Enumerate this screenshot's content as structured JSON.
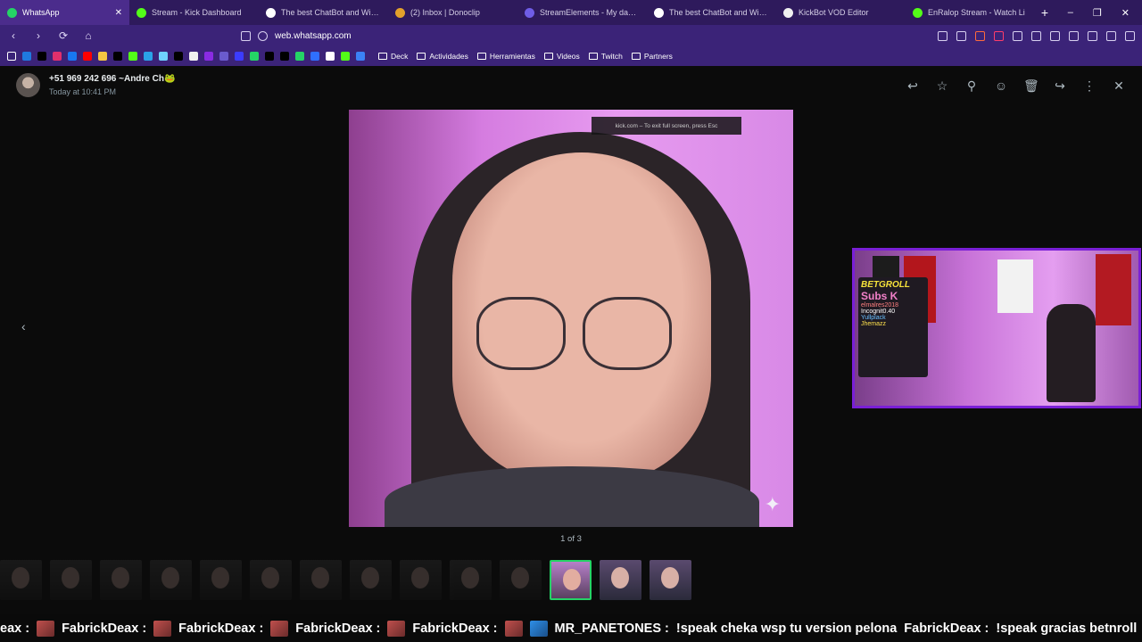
{
  "browser": {
    "tabs": [
      {
        "title": "WhatsApp",
        "fav": "#25d366",
        "active": true
      },
      {
        "title": "Stream - Kick Dashboard",
        "fav": "#53fc18"
      },
      {
        "title": "The best ChatBot and Widgets",
        "fav": "#ffffff"
      },
      {
        "title": "(2) Inbox | Donoclip",
        "fav": "#e3a12b"
      },
      {
        "title": "StreamElements - My dashboa",
        "fav": "#6f5de6"
      },
      {
        "title": "The best ChatBot and Widgets",
        "fav": "#ffffff"
      },
      {
        "title": "KickBot VOD Editor",
        "fav": "#f0f0f0"
      },
      {
        "title": "EnRalop Stream - Watch Li",
        "fav": "#53fc18"
      }
    ],
    "new_tab": "+",
    "window_controls": [
      "–",
      "❐",
      "✕"
    ],
    "url": "web.whatsapp.com",
    "nav": {
      "back": "‹",
      "forward": "›",
      "reload": "⟳",
      "home": "⌂"
    },
    "bookmark_icon_colors": [
      "#1f7ae0",
      "#000000",
      "#e1306c",
      "#1877f2",
      "#ff0000",
      "#f4c542",
      "#000000",
      "#53fc18",
      "#2aa3e8",
      "#6fd3ff",
      "#000000",
      "#f0f0f0",
      "#8a2be2",
      "#6a5acd",
      "#3c3cff",
      "#25d366",
      "#000000",
      "#000000",
      "#25d366",
      "#2f6fff",
      "#ffffff",
      "#53fc18",
      "#3b82f6"
    ],
    "bookmark_folders": [
      "Deck",
      "Actividades",
      "Herramientas",
      "Videos",
      "Twitch",
      "Partners"
    ]
  },
  "viewer": {
    "sender_name": "+51 969 242 696 ~Andre Ch🐸",
    "sender_time": "Today at 10:41 PM",
    "actions": [
      "reply-icon",
      "star-icon",
      "pin-icon",
      "emoji-icon",
      "delete-icon",
      "forward-icon",
      "menu-icon",
      "close-icon"
    ],
    "action_glyphs": [
      "↩",
      "☆",
      "⚲",
      "☺",
      "🗑",
      "↪",
      "⋮",
      "✕"
    ],
    "prev_arrow": "‹",
    "fullscreen_toast": "kick.com – To exit full screen, press  Esc",
    "counter": "1 of 3",
    "thumbnail_count": 14,
    "current_thumbnail": 11
  },
  "stream_overlay": {
    "brand": "BETGROLL",
    "subs": "Subs K",
    "lines": [
      "elmalres2018",
      "Incognit0.40",
      "Yullplack",
      "Jhemazz"
    ]
  },
  "ticker": [
    {
      "user": "eax :",
      "msg": ""
    },
    {
      "user": "FabrickDeax :",
      "msg": ""
    },
    {
      "user": "FabrickDeax :",
      "msg": ""
    },
    {
      "user": "FabrickDeax :",
      "msg": ""
    },
    {
      "user": "FabrickDeax :",
      "msg": ""
    },
    {
      "user": "MR_PANETONES :",
      "msg": "!speak cheka wsp tu version pelona",
      "emote": "blue"
    },
    {
      "user": "FabrickDeax :",
      "msg": "!speak gracias betnroll"
    }
  ]
}
